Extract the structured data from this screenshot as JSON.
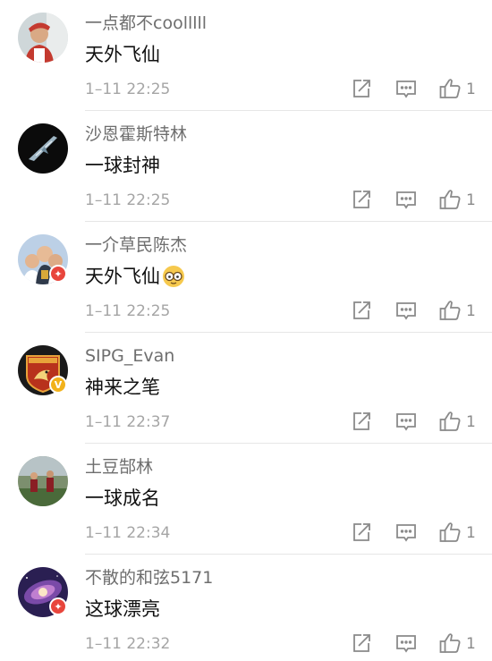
{
  "comments": [
    {
      "username": "一点都不coolllll",
      "text": "天外飞仙",
      "time": "1–11 22:25",
      "likes": "1",
      "avatar_color": "#c43a2f",
      "badge": null
    },
    {
      "username": "沙恩霍斯特林",
      "text": "一球封神",
      "time": "1–11 22:25",
      "likes": "1",
      "avatar_color": "#0d0d0d",
      "badge": null
    },
    {
      "username": "一介草民陈杰",
      "text": "天外飞仙",
      "time": "1–11 22:25",
      "likes": "1",
      "avatar_color": "#3a6bb5",
      "badge": "red",
      "emoji": "face-with-glasses-emoji"
    },
    {
      "username": "SIPG_Evan",
      "text": "神来之笔",
      "time": "1–11 22:37",
      "likes": "1",
      "avatar_color": "#b8321c",
      "badge": "gold"
    },
    {
      "username": "土豆郜林",
      "text": "一球成名",
      "time": "1–11 22:34",
      "likes": "1",
      "avatar_color": "#4a6a3a",
      "badge": null
    },
    {
      "username": "不散的和弦5171",
      "text": "这球漂亮",
      "time": "1–11 22:32",
      "likes": "1",
      "avatar_color": "#3a2a6e",
      "badge": "red"
    }
  ],
  "icons": {
    "share": "share-icon",
    "reply": "reply-icon",
    "like": "thumbs-up-icon"
  },
  "colors": {
    "username": "#6e6e6e",
    "text": "#111111",
    "time": "#a5a5a5",
    "icon": "#8a8a8a",
    "verified_red": "#e8453c",
    "verified_gold": "#f2b21b"
  }
}
